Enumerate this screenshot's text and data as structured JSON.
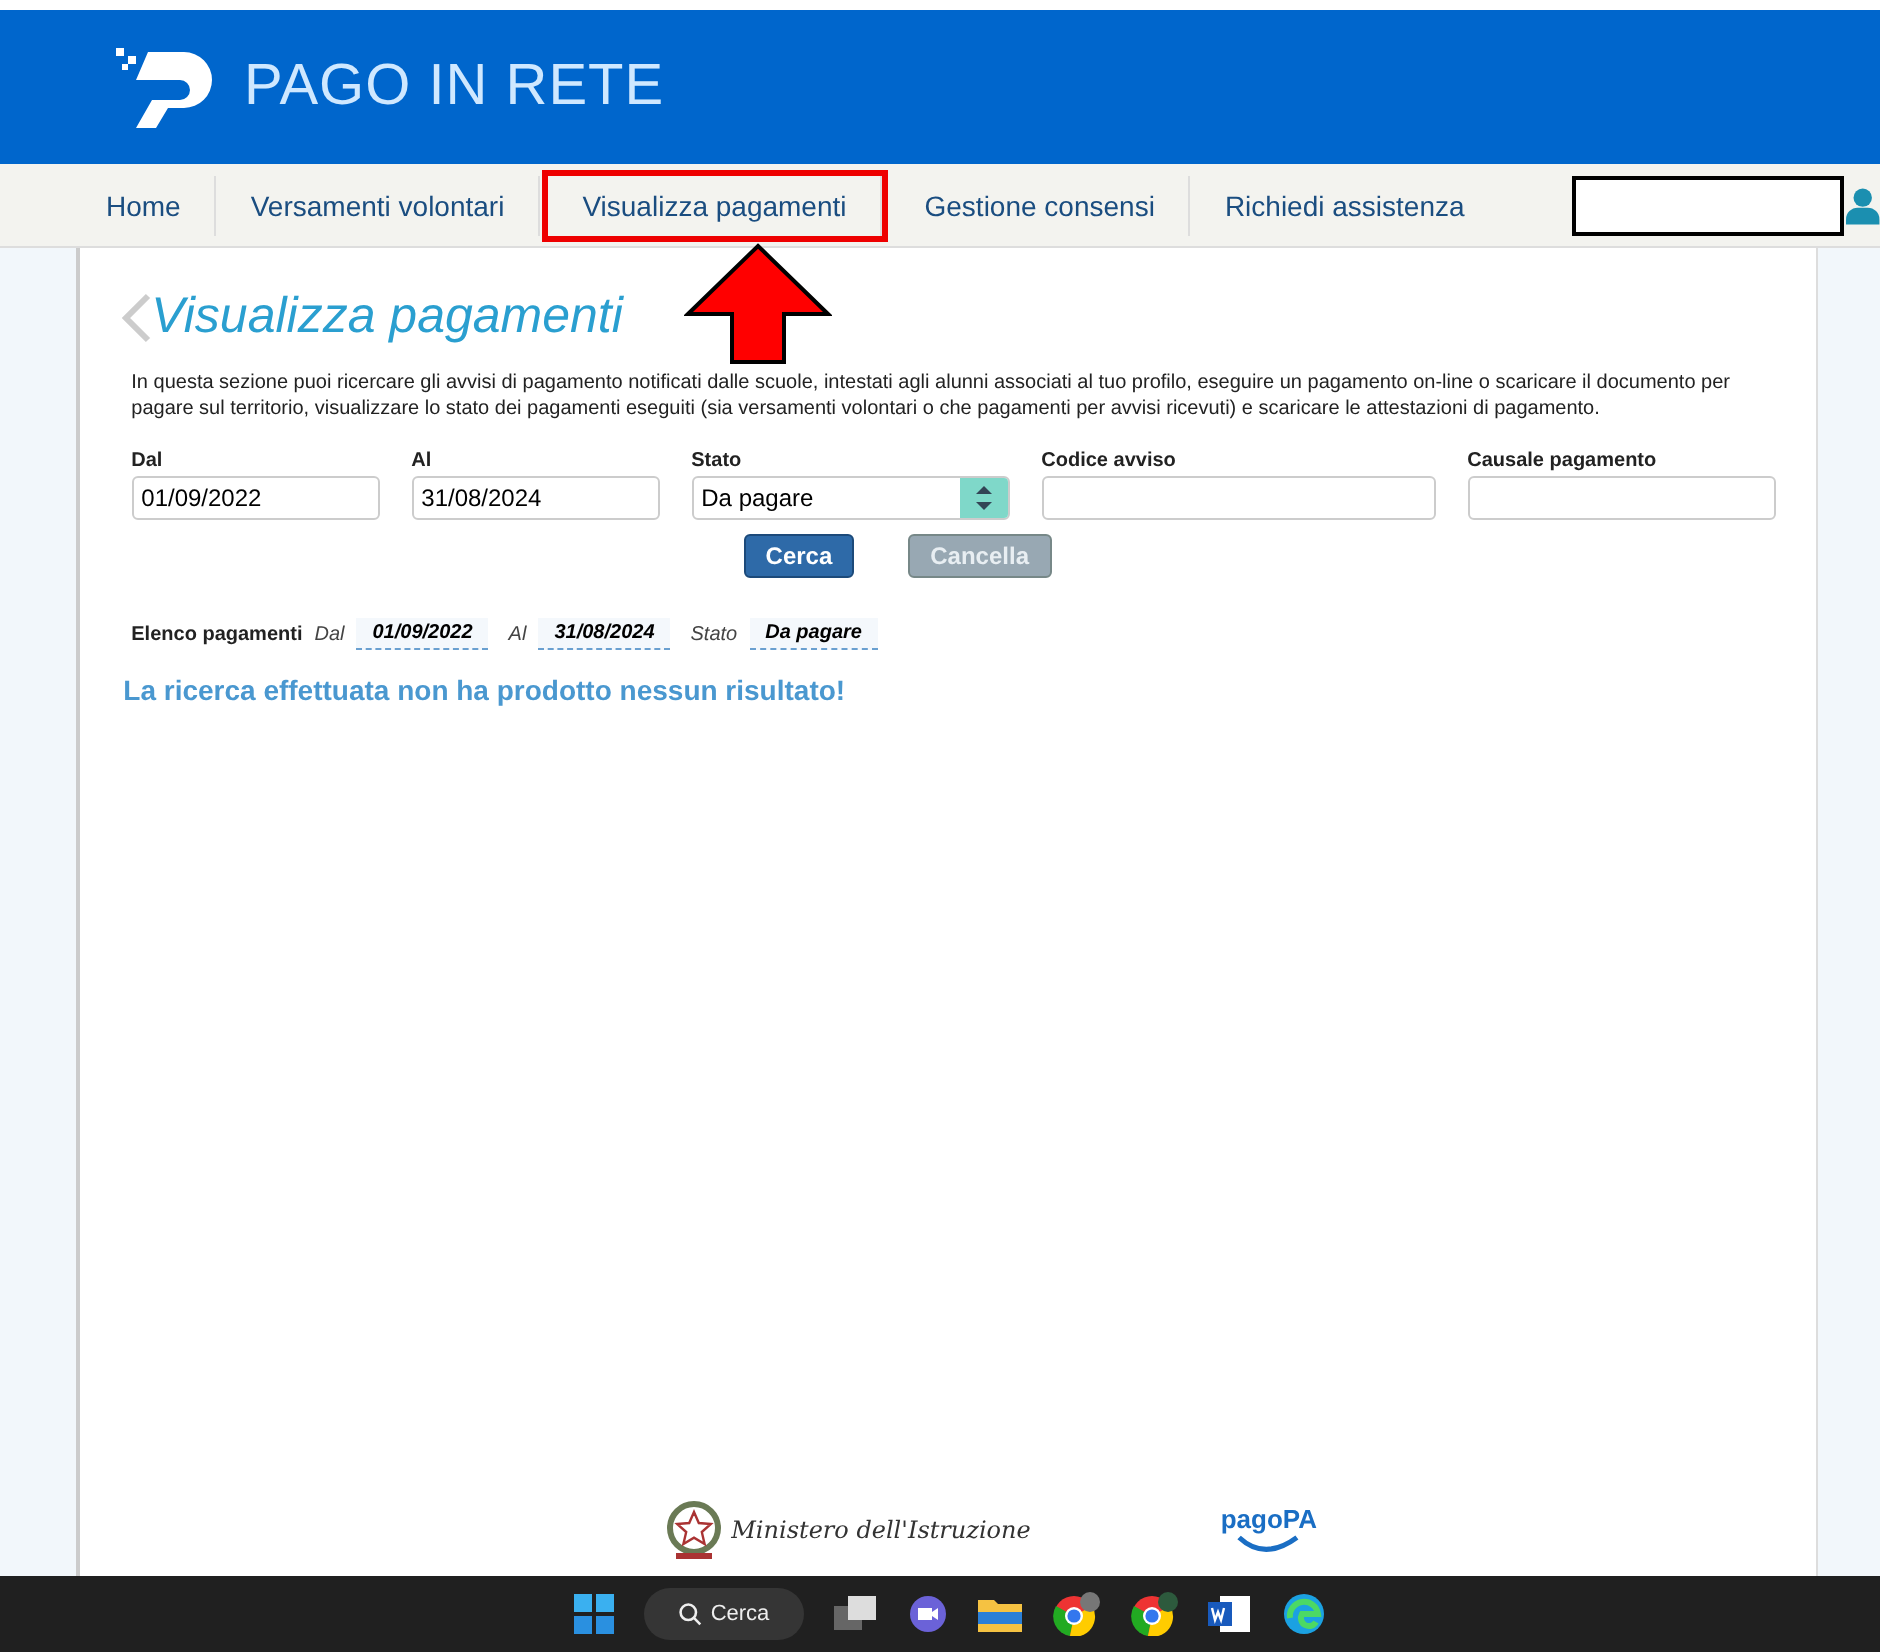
{
  "header": {
    "logo_text": "PAGO IN RETE"
  },
  "nav": {
    "items": [
      {
        "label": "Home",
        "selected": false
      },
      {
        "label": "Versamenti volontari",
        "selected": false
      },
      {
        "label": "Visualizza pagamenti",
        "selected": true
      },
      {
        "label": "Gestione consensi",
        "selected": false
      },
      {
        "label": "Richiedi assistenza",
        "selected": false
      }
    ]
  },
  "page": {
    "title": "Visualizza pagamenti",
    "intro": "In questa sezione puoi ricercare gli avvisi di pagamento notificati dalle scuole, intestati agli alunni associati al tuo profilo, eseguire un pagamento on-line o scaricare il documento per pagare sul territorio, visualizzare lo stato dei pagamenti eseguiti (sia versamenti volontari o che pagamenti per avvisi ricevuti) e scaricare le attestazioni di pagamento.",
    "filters": [
      {
        "kind": "text",
        "label": "Dal",
        "value": "01/09/2022"
      },
      {
        "kind": "text",
        "label": "Al",
        "value": "31/08/2024"
      },
      {
        "kind": "select",
        "label": "Stato",
        "value": "Da pagare"
      },
      {
        "kind": "text",
        "label": "Codice avviso"
      },
      {
        "kind": "text",
        "label": "Causale pagamento"
      }
    ],
    "buttons": [
      {
        "label": "Cerca",
        "disabled": false
      },
      {
        "label": "Cancella",
        "disabled": true
      }
    ],
    "summary": {
      "label": "Elenco pagamenti",
      "items": [
        {
          "label": "Dal",
          "value": "01/09/2022"
        },
        {
          "label": "Al",
          "value": "31/08/2024"
        },
        {
          "label": "Stato",
          "value": "Da pagare"
        }
      ]
    },
    "message": "La ricerca effettuata non ha prodotto nessun risultato!"
  },
  "footer": {
    "ministry": "Ministero dell'Istruzione",
    "pagopa": "pagoPA"
  },
  "taskbar": {
    "search": "Cerca"
  }
}
